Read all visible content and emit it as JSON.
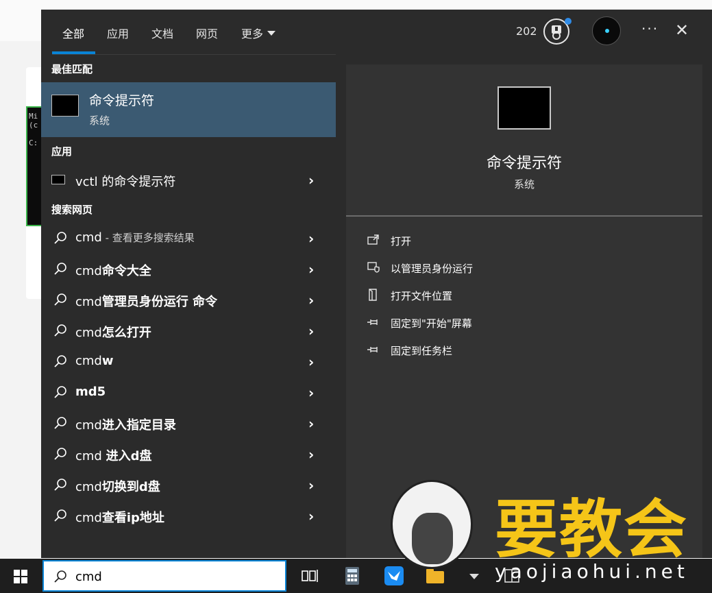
{
  "tabs": [
    {
      "label": "全部",
      "active": true
    },
    {
      "label": "应用"
    },
    {
      "label": "文档"
    },
    {
      "label": "网页"
    },
    {
      "label": "更多"
    }
  ],
  "header": {
    "points": "202",
    "more": "···",
    "close": "✕"
  },
  "sections": {
    "best": "最佳匹配",
    "apps": "应用",
    "web": "搜索网页"
  },
  "best_match": {
    "title": "命令提示符",
    "subtitle": "系统"
  },
  "apps": [
    {
      "label": "vctl 的命令提示符"
    }
  ],
  "web_results": [
    {
      "plain": "cmd",
      "hint": " - 查看更多搜索结果"
    },
    {
      "plain": "cmd",
      "bold": "命令大全"
    },
    {
      "plain": "cmd",
      "bold": "管理员身份运行 命令"
    },
    {
      "plain": "cmd",
      "bold": "怎么打开"
    },
    {
      "plain": "cmd",
      "bold": "w"
    },
    {
      "plain": "",
      "bold": "md5"
    },
    {
      "plain": "cmd",
      "bold": "进入指定目录"
    },
    {
      "plain": "cmd ",
      "bold": "进入d盘"
    },
    {
      "plain": "cmd",
      "bold": "切换到d盘"
    },
    {
      "plain": "cmd",
      "bold": "查看ip地址"
    }
  ],
  "preview": {
    "title": "命令提示符",
    "subtitle": "系统"
  },
  "actions": [
    {
      "label": "打开",
      "icon": "open-icon"
    },
    {
      "label": "以管理员身份运行",
      "icon": "admin-shield-icon"
    },
    {
      "label": "打开文件位置",
      "icon": "file-location-icon"
    },
    {
      "label": "固定到\"开始\"屏幕",
      "icon": "pin-icon"
    },
    {
      "label": "固定到任务栏",
      "icon": "pin-icon"
    }
  ],
  "search": {
    "value": "cmd"
  },
  "watermark": {
    "cn": "要教会",
    "en": "yaojiaohui.net"
  },
  "background": {
    "term_text": "Mi\n(c\n\nC:"
  },
  "colors": {
    "accent": "#0a84d6",
    "selected": "#3b5a72",
    "watermark": "#f5c518"
  }
}
